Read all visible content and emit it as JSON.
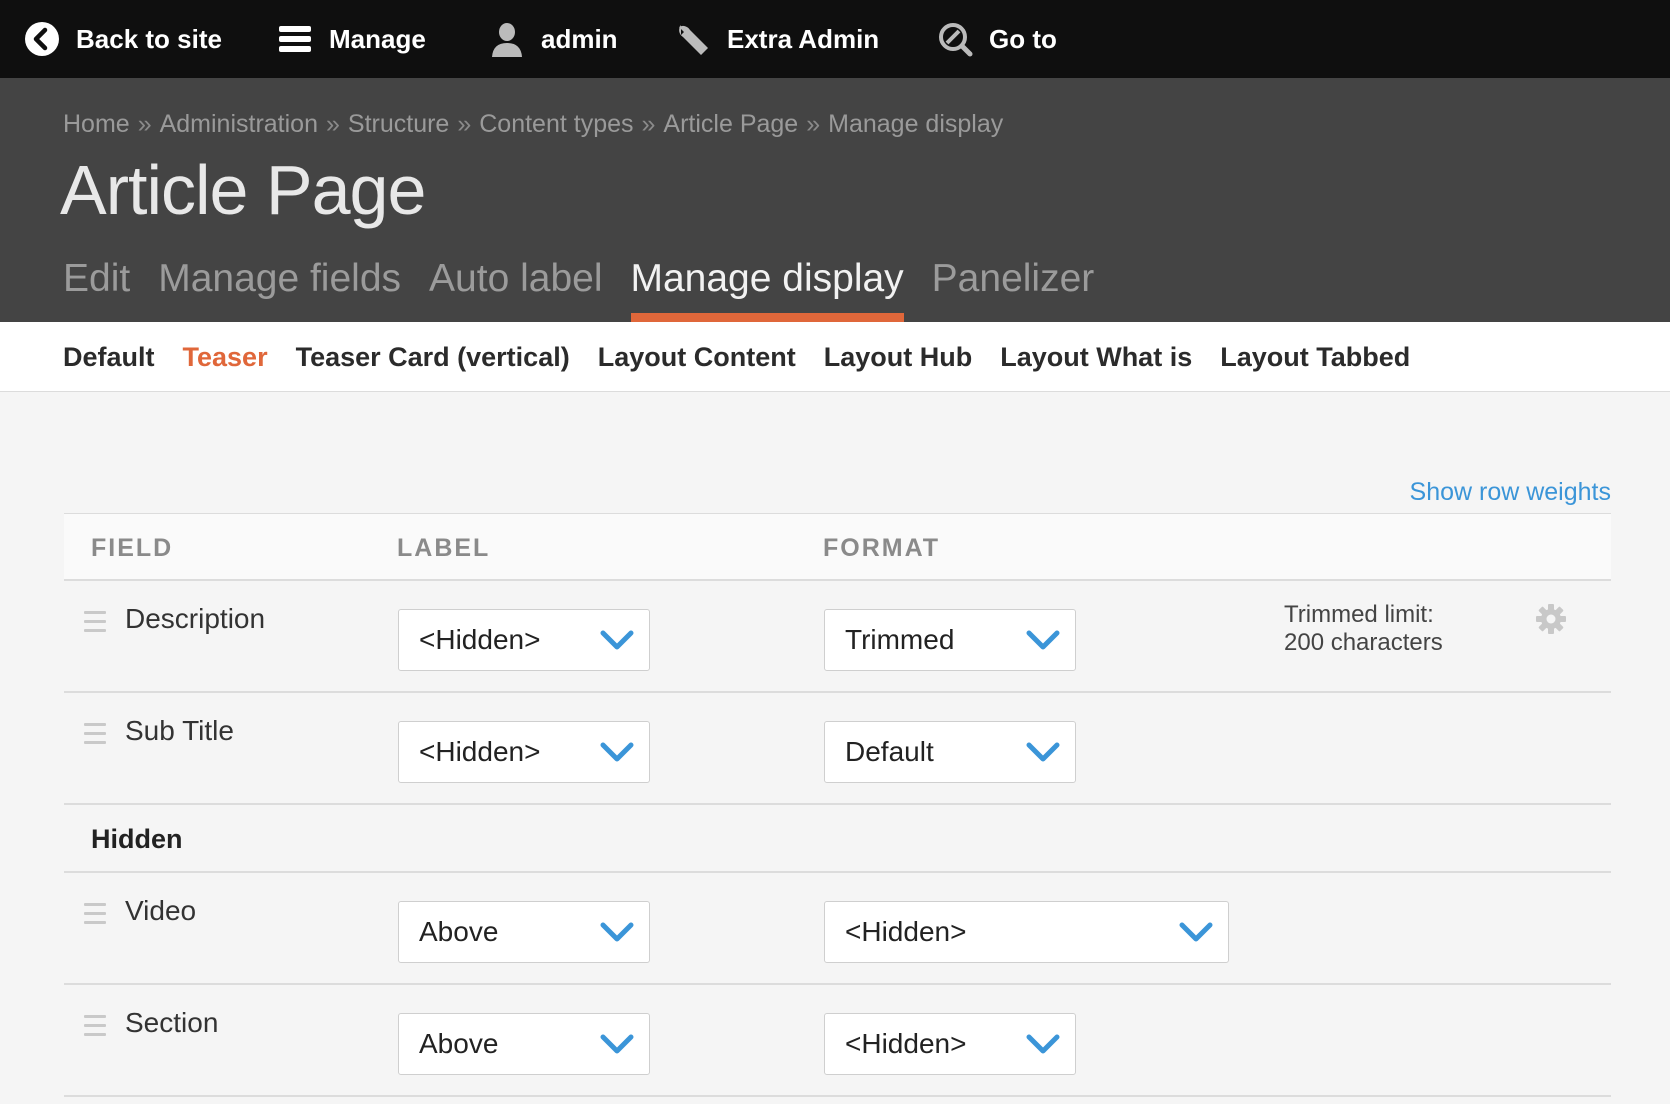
{
  "toolbar": {
    "items": [
      {
        "label": "Back to site",
        "icon": "arrow-left-circle-icon"
      },
      {
        "label": "Manage",
        "icon": "menu-icon"
      },
      {
        "label": "admin",
        "icon": "user-icon"
      },
      {
        "label": "Extra Admin",
        "icon": "wrench-icon"
      },
      {
        "label": "Go to",
        "icon": "search-icon"
      }
    ]
  },
  "header": {
    "breadcrumb": [
      "Home",
      "Administration",
      "Structure",
      "Content types",
      "Article Page",
      "Manage display"
    ],
    "separator": "»",
    "title": "Article Page",
    "tabs": [
      {
        "label": "Edit"
      },
      {
        "label": "Manage fields"
      },
      {
        "label": "Auto label"
      },
      {
        "label": "Manage display",
        "active": true
      },
      {
        "label": "Panelizer"
      }
    ]
  },
  "secondary_tabs": [
    {
      "label": "Default"
    },
    {
      "label": "Teaser",
      "active": true
    },
    {
      "label": "Teaser Card (vertical)"
    },
    {
      "label": "Layout Content"
    },
    {
      "label": "Layout Hub"
    },
    {
      "label": "Layout What is"
    },
    {
      "label": "Layout Tabbed"
    }
  ],
  "content": {
    "row_weights_link": "Show row weights",
    "columns": [
      "FIELD",
      "LABEL",
      "FORMAT"
    ],
    "rows": [
      {
        "field": "Description",
        "label": "<Hidden>",
        "format": "Trimmed",
        "summary_line1": "Trimmed limit:",
        "summary_line2": "200 characters"
      },
      {
        "field": "Sub Title",
        "label": "<Hidden>",
        "format": "Default"
      }
    ],
    "hidden_region_title": "Hidden",
    "hidden_rows": [
      {
        "field": "Video",
        "label": "Above",
        "format": "<Hidden>"
      },
      {
        "field": "Section",
        "label": "Above",
        "format": "<Hidden>"
      }
    ]
  },
  "colors": {
    "toolbar_bg": "#0f0f0f",
    "header_bg": "#444444",
    "accent": "#e0673a",
    "link": "#3b95d8",
    "chevron": "#3b95d8"
  }
}
